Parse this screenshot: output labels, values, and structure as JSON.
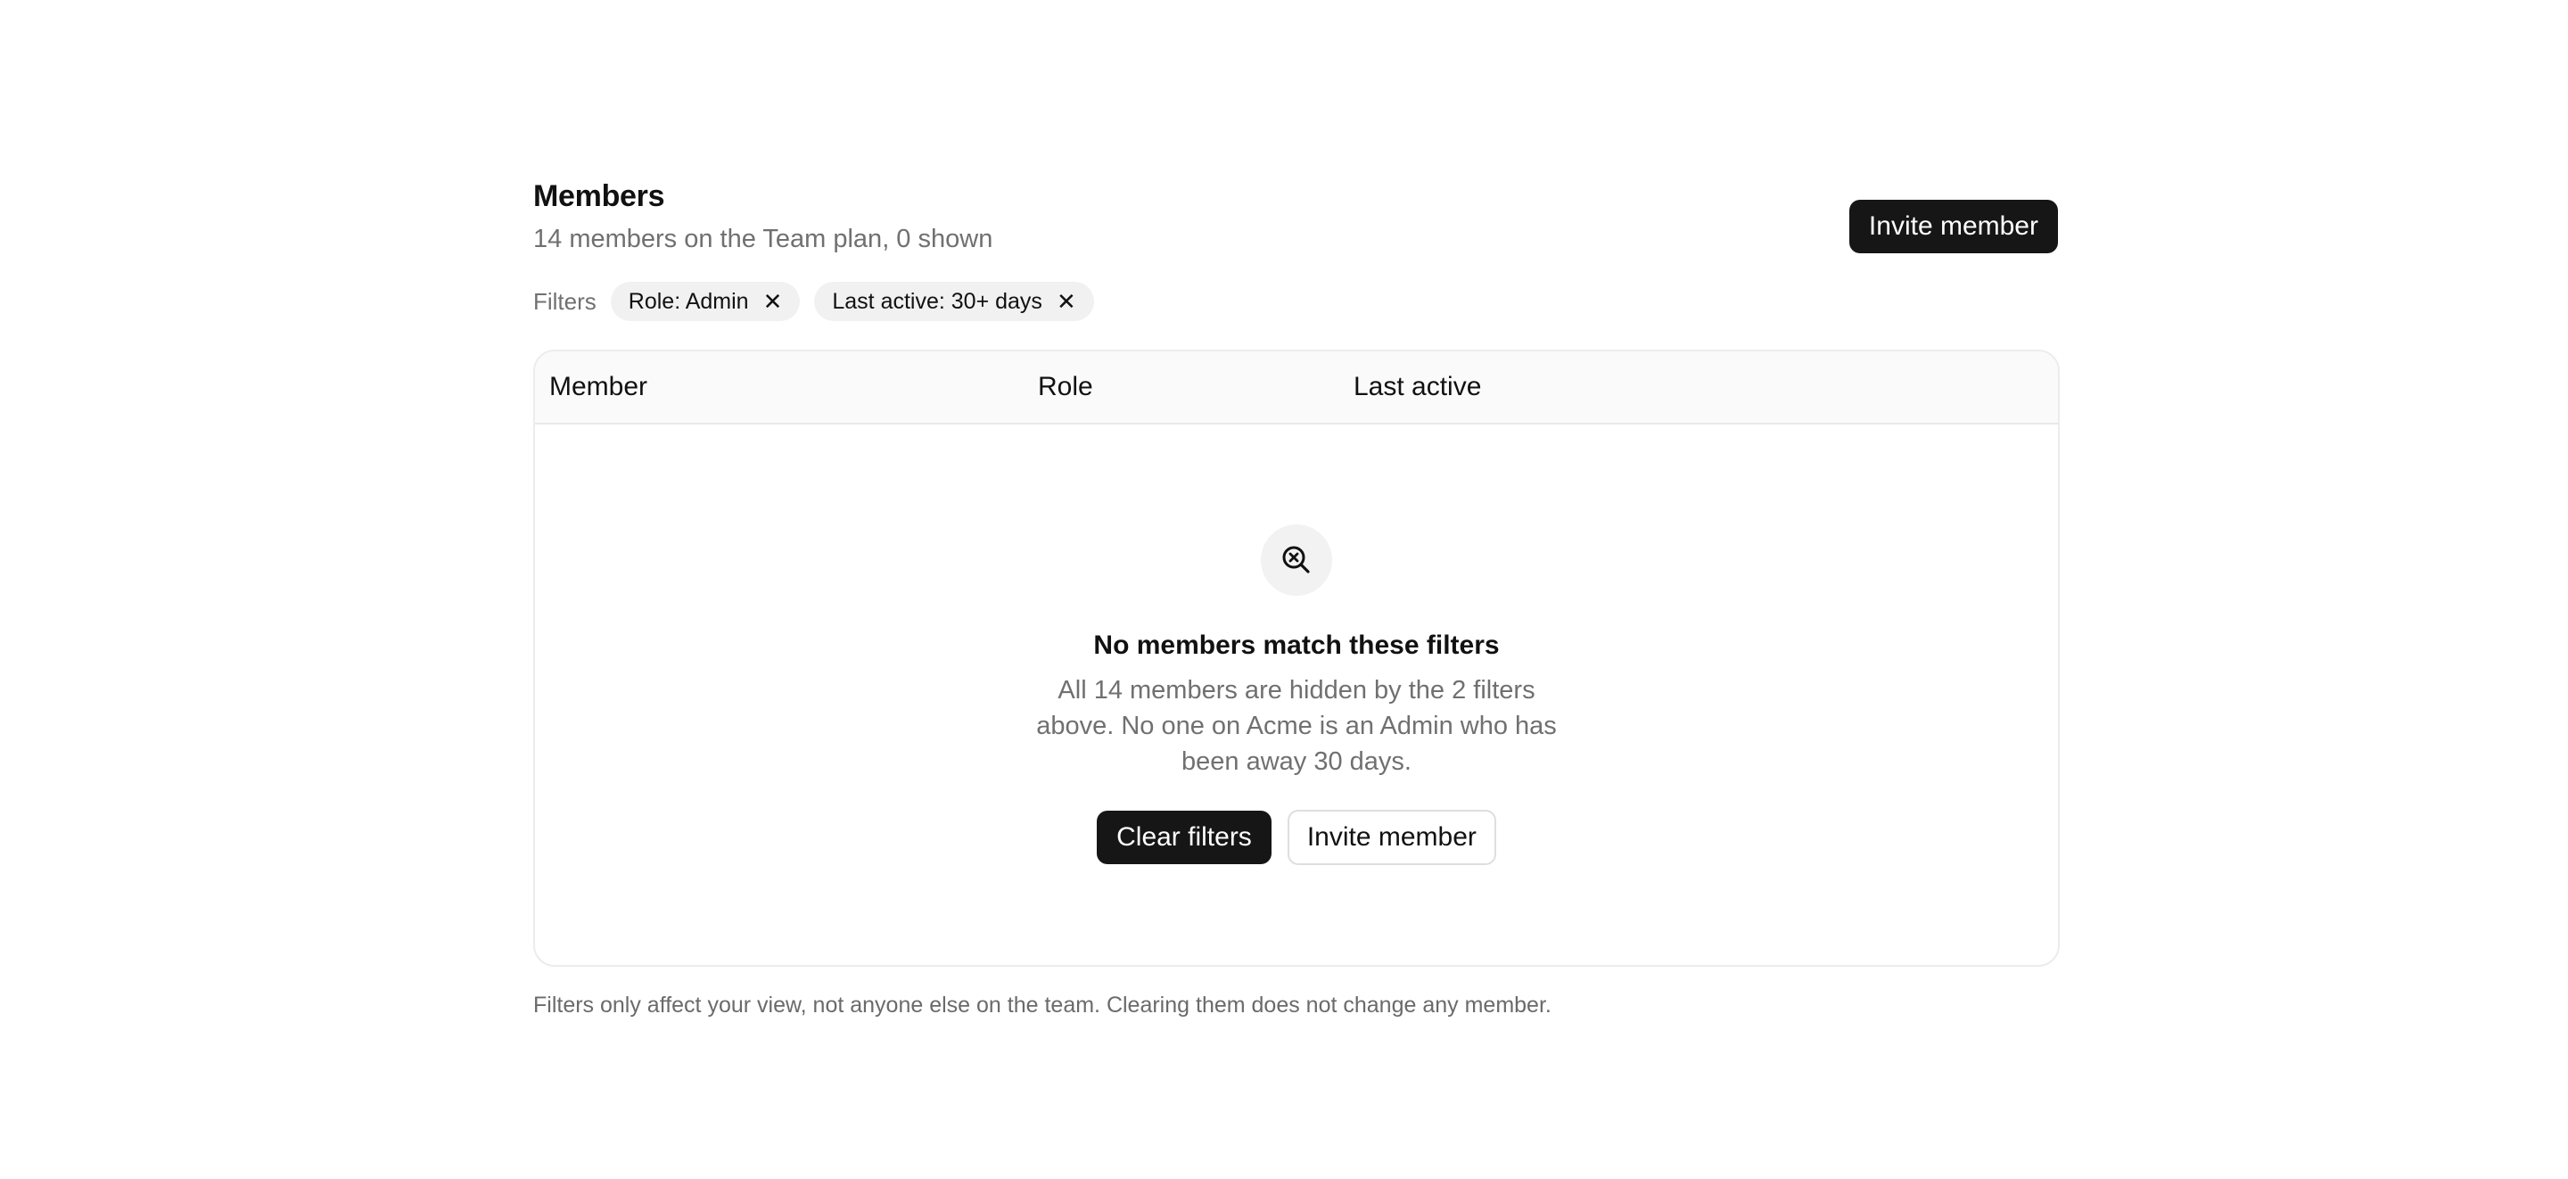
{
  "header": {
    "title": "Members",
    "subtitle": "14 members on the Team plan, 0 shown",
    "invite_label": "Invite member"
  },
  "filters": {
    "label": "Filters",
    "chips": [
      {
        "label": "Role: Admin",
        "remove_icon": "close-icon"
      },
      {
        "label": "Last active: 30+ days",
        "remove_icon": "close-icon"
      }
    ]
  },
  "table": {
    "columns": [
      "Member",
      "Role",
      "Last active"
    ],
    "rows": []
  },
  "empty_state": {
    "icon": "search-x-icon",
    "title": "No members match these filters",
    "description": "All 14 members are hidden by the 2 filters above. No one on Acme is an Admin who has been away 30 days.",
    "clear_label": "Clear filters",
    "invite_label": "Invite member"
  },
  "footnote": "Filters only affect your view, not anyone else on the team. Clearing them does not change any member."
}
